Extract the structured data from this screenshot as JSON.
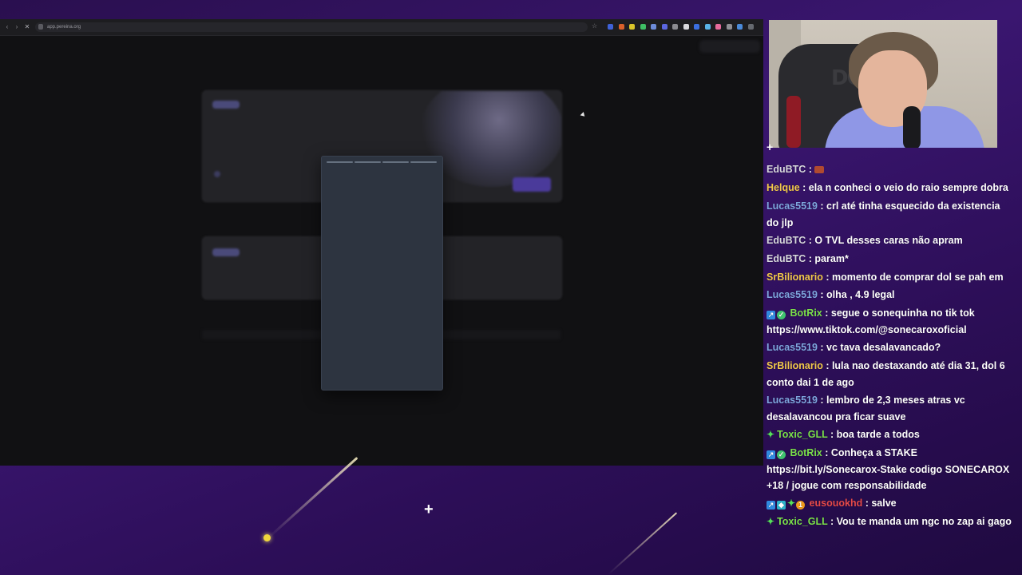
{
  "browser": {
    "url": "app.pereina.org",
    "icons": {
      "back": "arrow-left-icon",
      "forward": "arrow-right-icon",
      "reload": "close-icon",
      "bookmark": "star-icon"
    },
    "extension_colors": [
      "#3f62d8",
      "#d9602a",
      "#d9c52a",
      "#3ebf64",
      "#6d8bd9",
      "#5b66e0",
      "#8b8b90",
      "#d9d9de",
      "#3b6ee0",
      "#59b3e6",
      "#e66a9b",
      "#8f8f94",
      "#4a8ad9",
      "#666a70"
    ]
  },
  "chat": {
    "messages": [
      {
        "user": "EduBTC",
        "sep": " : ",
        "text": "",
        "user_color": "#d8d8de",
        "emote": "brick-emote"
      },
      {
        "user": "Helque",
        "sep": " : ",
        "text": "ela n conheci o veio do raio sempre dobra",
        "user_color": "#f2c94c"
      },
      {
        "user": "Lucas5519",
        "sep": " : ",
        "text": "crl até tinha esquecido da existencia",
        "text2": "do jlp",
        "user_color": "#7fa7e0"
      },
      {
        "user": "EduBTC",
        "sep": " : ",
        "text": "O TVL desses caras não apram",
        "user_color": "#d8d8de"
      },
      {
        "user": "EduBTC",
        "sep": " : ",
        "text": "param*",
        "user_color": "#d8d8de"
      },
      {
        "user": "SrBilionario",
        "sep": " : ",
        "text": "momento de comprar dol se pah em",
        "user_color": "#f2c94c"
      },
      {
        "user": "Lucas5519",
        "sep": " : ",
        "text": "olha , 4.9 legal",
        "user_color": "#7fa7e0"
      },
      {
        "user": "BotRix",
        "sep": " : ",
        "text": "segue o sonequinha no tik tok",
        "text2": "https://www.tiktok.com/@sonecaroxoficial",
        "user_color": "#7be14b"
      },
      {
        "user": "Lucas5519",
        "sep": " : ",
        "text": "vc tava desalavancado?",
        "user_color": "#7fa7e0"
      },
      {
        "user": "SrBilionario",
        "sep": " : ",
        "text": "lula nao destaxando até dia 31, dol 6",
        "text2": "conto dai 1 de ago",
        "user_color": "#f2c94c"
      },
      {
        "user": "Lucas5519",
        "sep": " : ",
        "text": "lembro de 2,3 meses atras vc",
        "text2": "desalavancou pra ficar suave",
        "user_color": "#7fa7e0"
      },
      {
        "user": "Toxic_GLL",
        "sep": " : ",
        "text": "boa tarde a todos",
        "user_color": "#7be14b"
      },
      {
        "user": "BotRix",
        "sep": " : ",
        "text": "Conheça a STAKE",
        "text2": "https://bit.ly/Sonecarox-Stake codigo SONECAROX",
        "text3": "+18 / jogue com responsabilidade",
        "user_color": "#7be14b"
      },
      {
        "user": "eusouokhd",
        "sep": " : ",
        "text": "salve",
        "user_color": "#e64a4a"
      },
      {
        "user": "Toxic_GLL",
        "sep": " : ",
        "text": "Vou te manda um ngc no zap ai gago",
        "user_color": "#7be14b"
      }
    ]
  },
  "overlay": {
    "plus_icon": "plus-icon",
    "colors": {
      "background": "#3a1670",
      "star": "#f0d63c"
    }
  }
}
